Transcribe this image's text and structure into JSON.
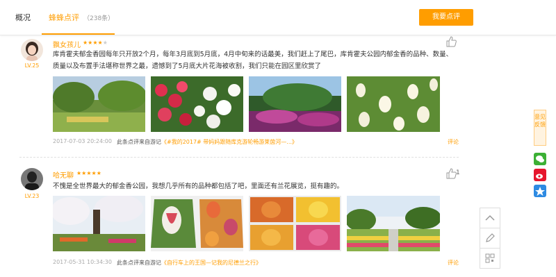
{
  "tabs": {
    "overview": "概况",
    "reviews": "蜂蜂点评",
    "reviews_count": "（238条）"
  },
  "write_button": "我要点评",
  "reviews": [
    {
      "user": "飘女孩儿",
      "level": "LV.25",
      "rating": 4,
      "text": "库肯霍夫郁金香园每年只开放2个月，每年3月底到5月底，4月中旬来的话最美，我们赶上了尾巴，库肯霍夫公园内郁金香的品种、数量、质量以及布置手法堪称世界之最，遗憾到了5月底大片花海被收割，我们只能在园区里欣赏了",
      "date": "2017-07-03 20:24:00",
      "source_prefix": "此条点评来自游记",
      "source_trip": "《#我的2017# 带妈妈跟随库克游轮畅游莱茵河—...》",
      "comment": "评论",
      "likes": ""
    },
    {
      "user": "哈无聊",
      "level": "LV.23",
      "rating": 5,
      "text": "不愧是全世界最大的郁金香公园，我想几乎所有的品种都包括了吧，里面还有兰花展览，挺有趣的。",
      "date": "2017-05-31 10:34:30",
      "source_prefix": "此条点评来自游记",
      "source_trip": "《自行车上的王国—记我的尼德兰之行》",
      "comment": "评论",
      "likes": "1"
    }
  ],
  "side": {
    "feedback": "意见反馈"
  },
  "icons": [
    "thumbs-up-icon",
    "wechat-icon",
    "weibo-icon",
    "qzone-icon",
    "arrow-up-icon",
    "pencil-icon",
    "qr-code-icon"
  ],
  "colors": {
    "accent": "#ff9d00"
  }
}
